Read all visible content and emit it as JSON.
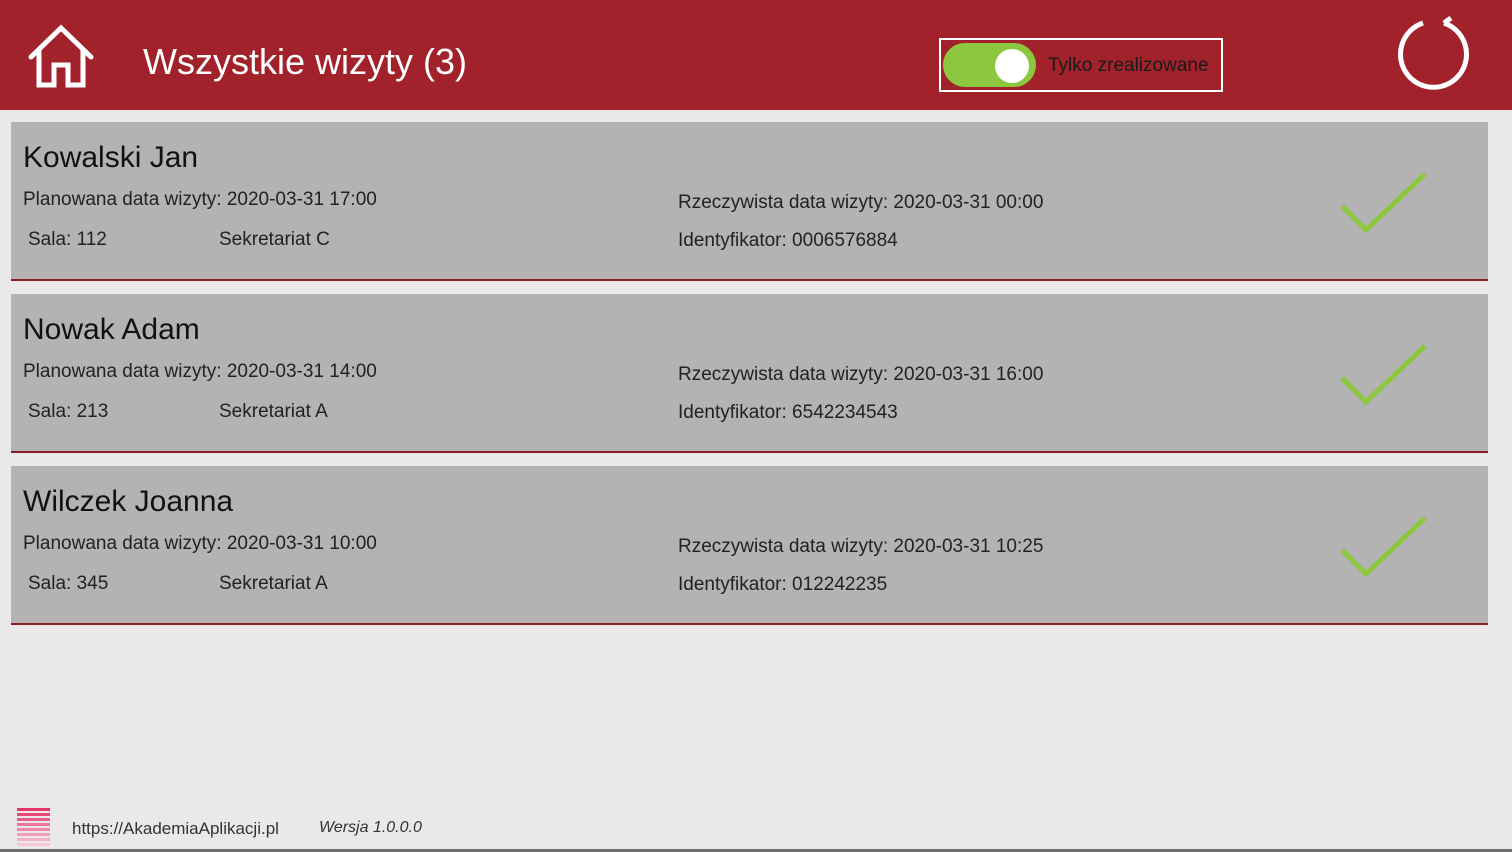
{
  "header": {
    "title": "Wszystkie wizyty (3)",
    "home_icon": "home-icon",
    "refresh_icon": "refresh-icon",
    "toggle": {
      "label": "Tylko zrealizowane",
      "checked": true
    }
  },
  "visits": [
    {
      "name": "Kowalski Jan",
      "planned": "Planowana data wizyty: 2020-03-31 17:00",
      "room": "Sala: 112",
      "office": "Sekretariat C",
      "actual": "Rzeczywista data wizyty: 2020-03-31 00:00",
      "identifier": "Identyfikator: 0006576884",
      "status_icon": "checkmark-icon"
    },
    {
      "name": "Nowak Adam",
      "planned": "Planowana data wizyty: 2020-03-31 14:00",
      "room": "Sala: 213",
      "office": "Sekretariat A",
      "actual": "Rzeczywista data wizyty: 2020-03-31 16:00",
      "identifier": "Identyfikator: 6542234543",
      "status_icon": "checkmark-icon"
    },
    {
      "name": "Wilczek Joanna",
      "planned": "Planowana data wizyty: 2020-03-31 10:00",
      "room": "Sala: 345",
      "office": "Sekretariat A",
      "actual": "Rzeczywista data wizyty: 2020-03-31 10:25",
      "identifier": "Identyfikator: 012242235",
      "status_icon": "checkmark-icon"
    }
  ],
  "footer": {
    "url": "https://AkademiaAplikacji.pl",
    "version": "Wersja 1.0.0.0",
    "logo_icon": "app-logo-icon"
  },
  "colors": {
    "header_bg": "#a2222b",
    "card_bg": "#b3b3b3",
    "accent_green": "#8dc63f",
    "page_bg": "#e9e9e9"
  }
}
